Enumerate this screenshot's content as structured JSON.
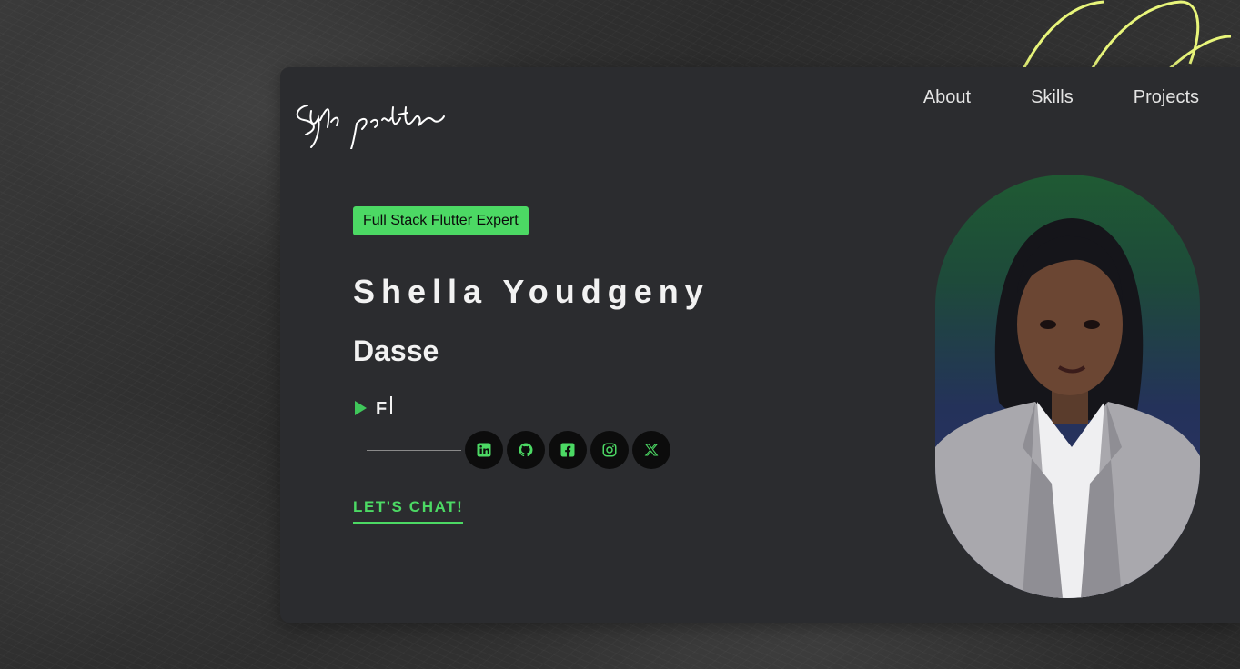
{
  "brand": {
    "logo_text": "Syds portfolio"
  },
  "nav": {
    "items": [
      "About",
      "Skills",
      "Projects"
    ]
  },
  "hero": {
    "badge": "Full Stack Flutter Expert",
    "name_line1": "Shella Youdgeny",
    "name_line2": "Dasse",
    "typing_text": "F",
    "cta": "LET'S CHAT!"
  },
  "socials": [
    "linkedin-icon",
    "github-icon",
    "facebook-icon",
    "instagram-icon",
    "x-icon"
  ],
  "colors": {
    "accent": "#4cd964",
    "card": "#2b2c2f",
    "deco_lines": "#e8f57a"
  }
}
